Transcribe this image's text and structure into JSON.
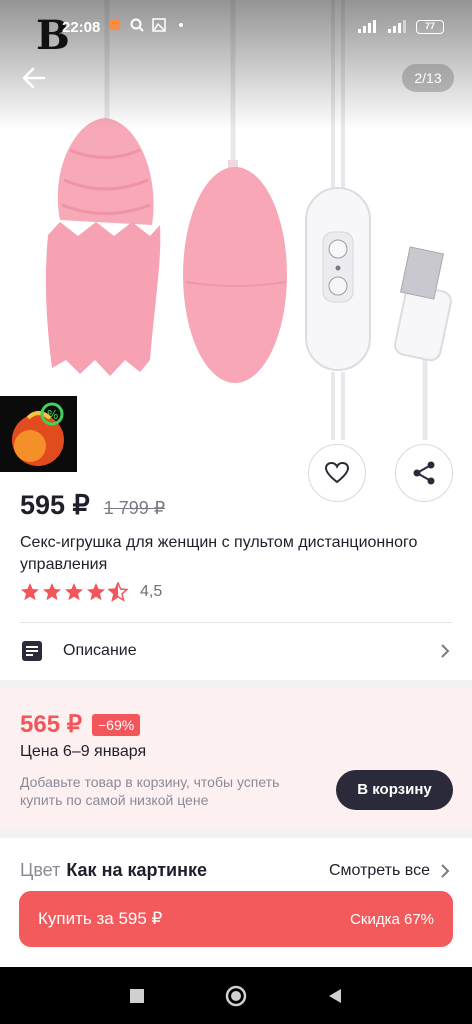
{
  "status_bar": {
    "logo": "B",
    "time": "22:08",
    "network": "4G",
    "battery": "77"
  },
  "header": {
    "page_counter": "2/13",
    "icons": [
      "arrow-left-icon"
    ]
  },
  "product": {
    "price": "595 ₽",
    "old_price": "1 799 ₽",
    "title": "Секс-игрушка для женщин с пультом дистанционного управления",
    "rating": 4.5,
    "rating_text": "4,5",
    "description_label": "Описание"
  },
  "promo": {
    "price": "565 ₽",
    "discount": "−69%",
    "dates": "Цена 6–9 января",
    "hint": "Добавьте товар в корзину, чтобы успеть купить по самой низкой цене",
    "cart_button": "В корзину"
  },
  "variants": {
    "color_label": "Цвет",
    "color_value": "Как на картинке",
    "see_all": "Смотреть все"
  },
  "buy": {
    "label": "Купить за 595 ₽",
    "savings": "Скидка 67%"
  },
  "colors": {
    "accent": "#f25a5c",
    "promo_price": "#f2555a",
    "promo_bg": "#fdf0f1",
    "dark_button": "#2a2a3a",
    "product_pink": "#f7a9b8"
  }
}
